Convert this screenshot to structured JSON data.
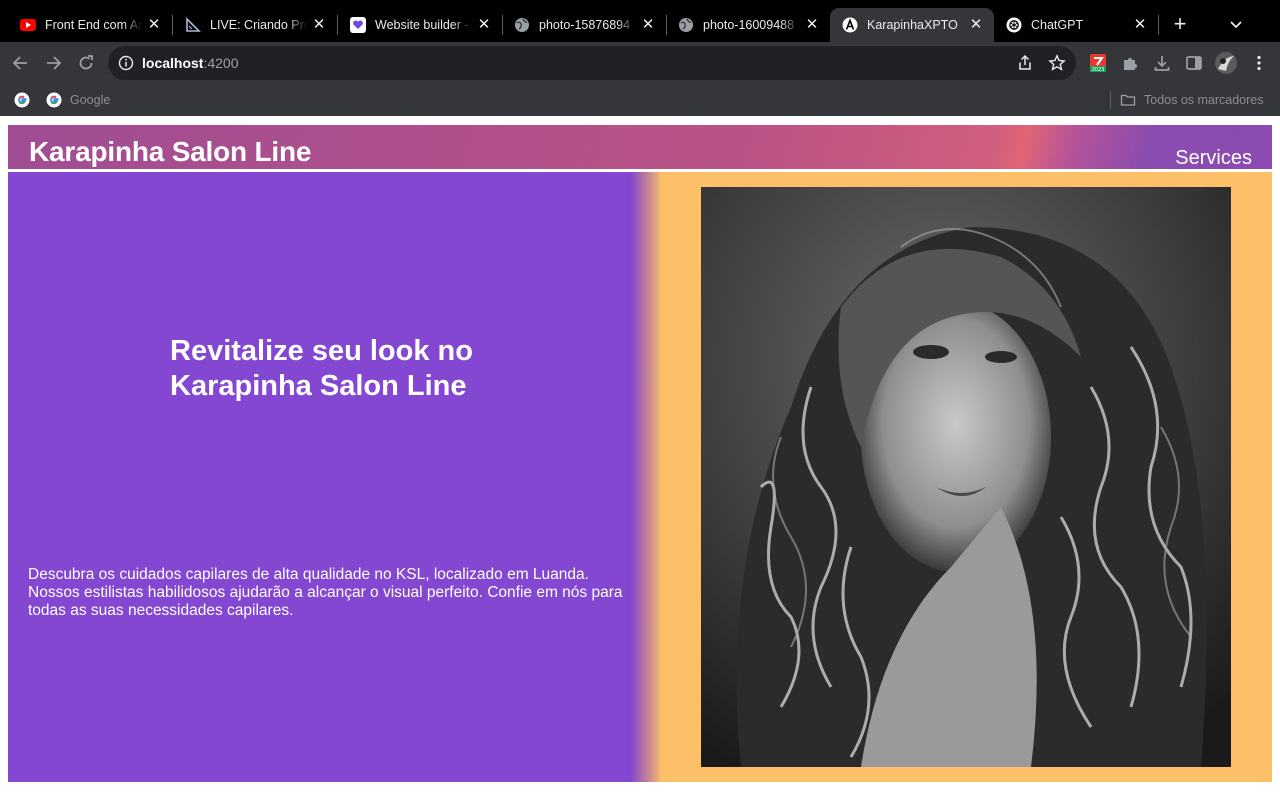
{
  "browser": {
    "tabs": [
      {
        "title": "Front End com An",
        "favicon": "youtube-icon",
        "active": false
      },
      {
        "title": "LIVE: Criando Pro",
        "favicon": "ruler-triangle-icon",
        "active": false
      },
      {
        "title": "Website builder -",
        "favicon": "heart-chat-icon",
        "active": false
      },
      {
        "title": "photo-15876894",
        "favicon": "globe-icon",
        "active": false
      },
      {
        "title": "photo-16009488",
        "favicon": "globe-icon",
        "active": false
      },
      {
        "title": "KarapinhaXPTO",
        "favicon": "angular-icon",
        "active": true
      },
      {
        "title": "ChatGPT",
        "favicon": "openai-icon",
        "active": false
      }
    ],
    "address": {
      "host": "localhost",
      "port": ":4200"
    },
    "bookmarks": [
      {
        "label": "",
        "icon": "google-icon"
      },
      {
        "label": "Google",
        "icon": "google-icon"
      }
    ],
    "all_bookmarks_label": "Todos os marcadores",
    "extension_badge": "2023"
  },
  "site": {
    "brand": "Karapinha Salon Line",
    "nav": {
      "services": "Services"
    },
    "hero": {
      "title": "Revitalize seu look no Karapinha Salon Line",
      "description": "Descubra os cuidados capilares de alta qualidade no KSL, localizado em Luanda. Nossos estilistas habilidosos ajudarão a alcançar o visual perfeito. Confie em nós para todas as suas necessidades capilares.",
      "image_subject": "black-and-white portrait of a woman with long curly hair"
    },
    "colors": {
      "header_gradient": "#b0508b",
      "hero_left": "#8447d2",
      "hero_right": "#fdbf68"
    }
  }
}
